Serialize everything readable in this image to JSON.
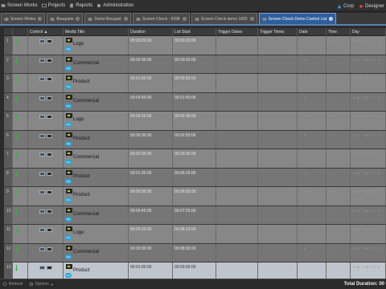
{
  "nav": {
    "items": [
      {
        "label": "Screen Works",
        "icon": "screen-works-icon"
      },
      {
        "label": "Projects",
        "icon": "projects-icon"
      },
      {
        "label": "Reports",
        "icon": "reports-icon"
      },
      {
        "label": "Administration",
        "icon": "administration-icon"
      }
    ],
    "right": [
      {
        "label": "Corp",
        "icon": "corp-icon"
      },
      {
        "label": "Designer",
        "icon": "designer-icon"
      }
    ]
  },
  "tabs": [
    {
      "label": "Screen Works",
      "active": false
    },
    {
      "label": "Bouquets",
      "active": false
    },
    {
      "label": "Demo Bouquet",
      "active": false
    },
    {
      "label": "Screen Check - 9298",
      "active": false
    },
    {
      "label": "Screen Check demo 1665",
      "active": false
    },
    {
      "label": "Screen Check Demo Control List",
      "active": true
    }
  ],
  "columns": {
    "num": "",
    "arrow": "",
    "control": "Control ▲",
    "media": "Media Title",
    "duration": "Duration",
    "list_start": "List Start",
    "trigger_dates": "Trigger Dates",
    "trigger_times": "Trigger Times",
    "date": "Date",
    "time": "Time",
    "day": "Day"
  },
  "rows": [
    {
      "n": "1",
      "title": "Logo",
      "duration": "00:00:20:00",
      "start": "00:00:20:00",
      "date": "-",
      "time": "-",
      "day": "S M T W T F S"
    },
    {
      "n": "2",
      "title": "Commercial",
      "duration": "00:00:30:00",
      "start": "00:00:20:00",
      "date": "-",
      "time": "-",
      "day": "S M T W T F S"
    },
    {
      "n": "3",
      "title": "Product",
      "duration": "00:01:00:00",
      "start": "00:00:50:00",
      "date": "-",
      "time": "-",
      "day": "S M T W T F S"
    },
    {
      "n": "4",
      "title": "Commercial",
      "duration": "00:00:40:00",
      "start": "00:01:50:00",
      "date": "-",
      "time": "-",
      "day": "S M T W T F S"
    },
    {
      "n": "5",
      "title": "Logo",
      "duration": "00:00:20:00",
      "start": "00:02:35:00",
      "date": "-",
      "time": "-",
      "day": "S M T W T F S"
    },
    {
      "n": "6",
      "title": "Product",
      "duration": "00:00:30:00",
      "start": "00:02:55:00",
      "date": "-",
      "time": "-",
      "day": "S M T W T F S"
    },
    {
      "n": "7",
      "title": "Commercial",
      "duration": "00:02:00:00",
      "start": "00:03:25:00",
      "date": "-",
      "time": "-",
      "day": "S M T W T F S"
    },
    {
      "n": "8",
      "title": "Product",
      "duration": "00:01:30:00",
      "start": "00:05:25:00",
      "date": "-",
      "time": "-",
      "day": "S M T W T F S"
    },
    {
      "n": "9",
      "title": "Product",
      "duration": "00:00:30:00",
      "start": "00:06:55:00",
      "date": "-",
      "time": "-",
      "day": "S M T W T F S"
    },
    {
      "n": "10",
      "title": "Commercial",
      "duration": "00:00:45:00",
      "start": "00:07:25:00",
      "date": "-",
      "time": "-",
      "day": "S M T W T F S"
    },
    {
      "n": "11",
      "title": "Logo",
      "duration": "00:00:20:00",
      "start": "00:08:10:00",
      "date": "-",
      "time": "-",
      "day": "S M T W T F S"
    },
    {
      "n": "12",
      "title": "Commercial",
      "duration": "00:00:30:00",
      "start": "00:08:30:00",
      "date": "-",
      "time": "-",
      "day": "S M T W T F S"
    },
    {
      "n": "13",
      "title": "Product",
      "duration": "00:01:00:00",
      "start": "00:09:00:00",
      "date": "",
      "time": "",
      "day": "S M T W T F S"
    }
  ],
  "badge_text": "Clip",
  "bottom": {
    "refresh": "Refresh",
    "options": "Options",
    "total": "Total Duration: 00"
  },
  "colors": {
    "accent": "#2f5e9c",
    "badge": "#22a7e0",
    "arrow": "#3cb043"
  }
}
